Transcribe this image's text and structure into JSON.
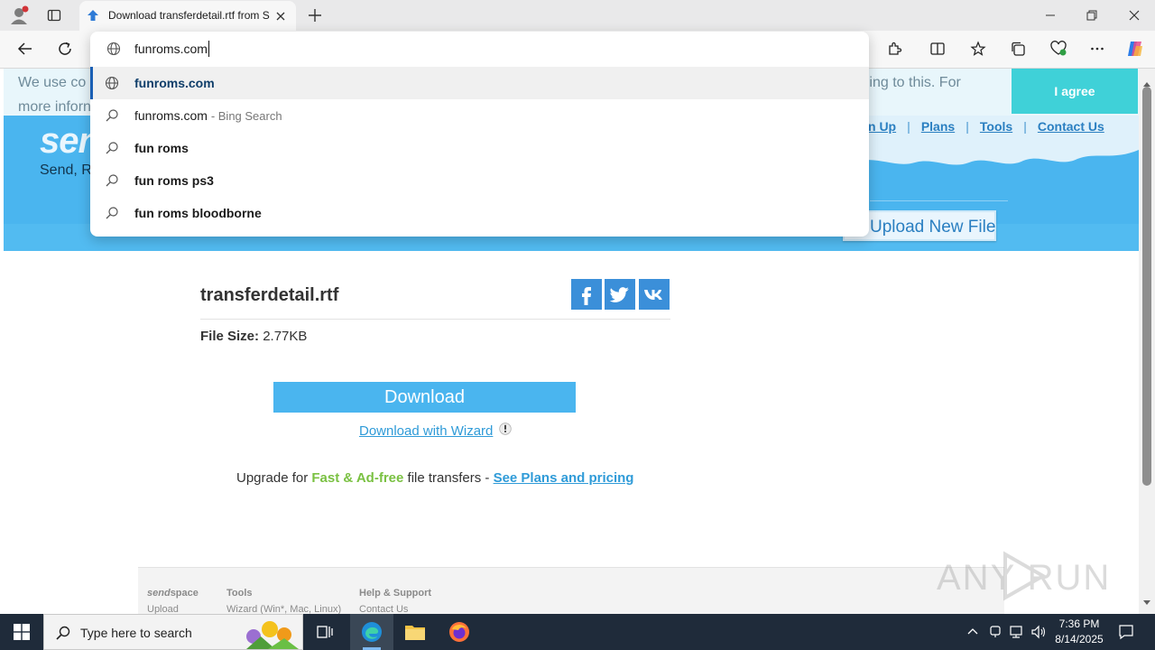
{
  "browser": {
    "tab_title": "Download transferdetail.rtf from S",
    "address_value": "funroms.com",
    "suggestions": [
      {
        "icon": "globe-icon",
        "text": "funroms.com",
        "suffix": "",
        "bold": true,
        "highlighted": true
      },
      {
        "icon": "search-icon",
        "text": "funroms.com",
        "suffix": "- Bing Search",
        "bold": false,
        "highlighted": false
      },
      {
        "icon": "search-icon",
        "text": "fun roms",
        "suffix": "",
        "bold": true,
        "highlighted": false
      },
      {
        "icon": "search-icon",
        "text": "fun roms ps3",
        "suffix": "",
        "bold": true,
        "highlighted": false
      },
      {
        "icon": "search-icon",
        "text": "fun roms bloodborne",
        "suffix": "",
        "bold": true,
        "highlighted": false
      }
    ]
  },
  "cookie": {
    "text_line1_start": "We use co",
    "text_line1_end": "reeing to this. For",
    "text_line2": "more inforn",
    "agree_label": "I agree"
  },
  "site": {
    "logo_partial": "sen",
    "tagline_partial": "Send, R",
    "nav": [
      "n Up",
      "Plans",
      "Tools",
      "Contact Us"
    ],
    "upload_button": "Upload New File"
  },
  "file": {
    "name": "transferdetail.rtf",
    "size_label": "File Size:",
    "size_value": "2.77KB",
    "download_label": "Download",
    "wizard_label": "Download with Wizard",
    "upgrade_prefix": "Upgrade for ",
    "upgrade_highlight": "Fast & Ad-free",
    "upgrade_middle": " file transfers - ",
    "upgrade_link": "See Plans and pricing",
    "social": [
      "facebook-icon",
      "twitter-icon",
      "vk-icon"
    ]
  },
  "footer": {
    "col1_title_a": "send",
    "col1_title_b": "space",
    "col1_item": "Upload",
    "col2_title": "Tools",
    "col2_item": "Wizard (Win*, Mac, Linux)",
    "col3_title": "Help & Support",
    "col3_item": "Contact Us"
  },
  "watermark": {
    "text": "ANY RUN"
  },
  "taskbar": {
    "search_placeholder": "Type here to search",
    "time": "7:36 PM",
    "date": "8/14/2025"
  },
  "colors": {
    "accent_blue": "#4ab5ef",
    "link_blue": "#2f9bd8",
    "green": "#7ac142",
    "facebook": "#3b8fd9",
    "agree": "#3fd1d8"
  }
}
